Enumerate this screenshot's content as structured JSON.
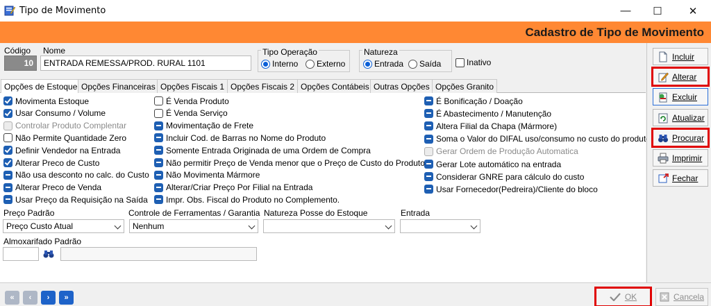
{
  "window": {
    "title": "Tipo de Movimento",
    "minimize_glyph": "—",
    "maximize_glyph": "☐",
    "close_glyph": "✕"
  },
  "banner": {
    "title": "Cadastro de Tipo de Movimento",
    "color": "#ff8833"
  },
  "header": {
    "codigo_label": "Código",
    "codigo_value": "10",
    "nome_label": "Nome",
    "nome_value": "ENTRADA REMESSA/PROD. RURAL 1101",
    "tipo_operacao": {
      "label": "Tipo Operação",
      "options": [
        "Interno",
        "Externo"
      ],
      "selected": "Interno"
    },
    "natureza": {
      "label": "Natureza",
      "options": [
        "Entrada",
        "Saída"
      ],
      "selected": "Entrada"
    },
    "inativo_label": "Inativo",
    "inativo_checked": false
  },
  "tabs": [
    "Opções de Estoque",
    "Opções Financeiras",
    "Opções Fiscais 1",
    "Opções Fiscais 2",
    "Opções Contábeis",
    "Outras Opções",
    "Opções Granito"
  ],
  "active_tab": "Opções de Estoque",
  "options_col1": [
    {
      "label": "Movimenta Estoque",
      "state": "checked"
    },
    {
      "label": "Usar Consumo / Volume",
      "state": "checked"
    },
    {
      "label": "Controlar Produto Complentar",
      "state": "disabled"
    },
    {
      "label": "Não Permite Quantidade Zero",
      "state": "unchecked"
    },
    {
      "label": "Definir Vendedor na Entrada",
      "state": "checked"
    },
    {
      "label": "Alterar Preco de Custo",
      "state": "checked"
    },
    {
      "label": "Não usa desconto no calc. do Custo",
      "state": "indeterminate"
    },
    {
      "label": "Alterar Preco de Venda",
      "state": "indeterminate"
    },
    {
      "label": "Usar Preço da Requisição na Saída",
      "state": "indeterminate"
    }
  ],
  "options_col2": [
    {
      "label": "É Venda Produto",
      "state": "unchecked"
    },
    {
      "label": "É Venda Serviço",
      "state": "unchecked"
    },
    {
      "label": "Movimentação de Frete",
      "state": "indeterminate"
    },
    {
      "label": "Incluir Cod. de Barras no Nome do Produto",
      "state": "indeterminate"
    },
    {
      "label": "Somente Entrada Originada de uma Ordem de Compra",
      "state": "indeterminate"
    },
    {
      "label": "Não permitir Preço de Venda menor que o Preço de Custo do Produto",
      "state": "indeterminate"
    },
    {
      "label": "Não Movimenta Mármore",
      "state": "indeterminate"
    },
    {
      "label": "Alterar/Criar Preço Por Filial na Entrada",
      "state": "indeterminate"
    },
    {
      "label": "Impr. Obs. Fiscal do Produto no Complemento.",
      "state": "indeterminate"
    }
  ],
  "options_col3": [
    {
      "label": "É Bonificação / Doação",
      "state": "indeterminate"
    },
    {
      "label": "É Abastecimento / Manutenção",
      "state": "indeterminate"
    },
    {
      "label": "Altera Filial da Chapa (Mármore)",
      "state": "indeterminate"
    },
    {
      "label": "Soma o Valor do DIFAL uso/consumo no custo do produto",
      "state": "indeterminate"
    },
    {
      "label": "Gerar Ordem de Produção Automatica",
      "state": "disabled"
    },
    {
      "label": "Gerar Lote automático na entrada",
      "state": "indeterminate"
    },
    {
      "label": "Considerar GNRE para cálculo do custo",
      "state": "indeterminate"
    },
    {
      "label": "Usar Fornecedor(Pedreira)/Cliente do bloco",
      "state": "indeterminate"
    }
  ],
  "dropdowns": {
    "preco_padrao": {
      "label": "Preço Padrão",
      "value": "Preço Custo Atual"
    },
    "controle_ferramentas": {
      "label": "Controle de Ferramentas / Garantia",
      "value": "Nenhum"
    },
    "natureza_posse": {
      "label": "Natureza Posse do Estoque",
      "value": ""
    },
    "entrada": {
      "label": "Entrada",
      "value": ""
    }
  },
  "almoxarifado": {
    "label": "Almoxarifado Padrão",
    "code": "",
    "name": ""
  },
  "side_buttons": [
    {
      "label": "Incluir",
      "icon": "new-document-icon"
    },
    {
      "label": "Alterar",
      "icon": "edit-pencil-icon"
    },
    {
      "label": "Excluir",
      "icon": "delete-icon"
    },
    {
      "label": "Atualizar",
      "icon": "refresh-icon"
    },
    {
      "label": "Procurar",
      "icon": "binoculars-icon"
    },
    {
      "label": "Imprimir",
      "icon": "printer-icon"
    },
    {
      "label": "Fechar",
      "icon": "close-door-icon"
    }
  ],
  "nav": {
    "first": "«",
    "prev": "‹",
    "next": "›",
    "last": "»"
  },
  "footer": {
    "ok_label": "OK",
    "cancel_label": "Cancela"
  },
  "colors": {
    "highlight": "#e00000",
    "checkbox_blue": "#1e5fb3",
    "banner_orange": "#ff8833"
  }
}
